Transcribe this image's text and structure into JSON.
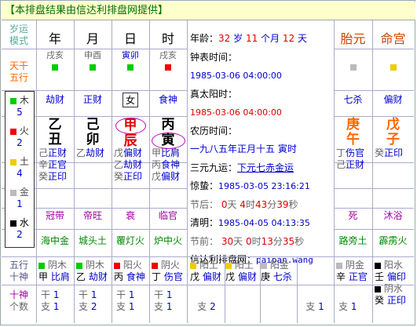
{
  "title": "【本排盘结果由信达利排盘网提供】",
  "left_col": {
    "header": [
      "岁运",
      "模式"
    ],
    "tiangan_wuxing": [
      "天干",
      "五行"
    ],
    "elements": [
      {
        "name": "木",
        "count": "5",
        "color": "#00cc00"
      },
      {
        "name": "火",
        "count": "2",
        "color": "#ee0000"
      },
      {
        "name": "土",
        "count": "4",
        "color": "#eecc00"
      },
      {
        "name": "金",
        "count": "1",
        "color": "#bbbbbb"
      },
      {
        "name": "水",
        "count": "2",
        "color": "#000000"
      }
    ],
    "wuxing_shishen": [
      "五行",
      "十神"
    ],
    "shishen_count": [
      "十神",
      "个数"
    ]
  },
  "pillars": [
    {
      "header": "年",
      "nayin_top": "戌亥",
      "sq_color": "#00cc00",
      "shishen": "劫财",
      "gan": "乙",
      "zhi": "丑",
      "canggan": [
        [
          "己",
          "正财"
        ],
        [
          "辛",
          "正官"
        ],
        [
          "癸",
          "正印"
        ]
      ],
      "changsheng": "冠带",
      "nayin": "海中金",
      "wx": [
        [
          "阴木",
          "#00cc00"
        ],
        [
          "甲",
          "比肩"
        ]
      ],
      "count": [
        "干 1",
        "支 1"
      ]
    },
    {
      "header": "月",
      "nayin_top": "申酉",
      "sq_color": "#00cc00",
      "shishen": "正财",
      "gan": "己",
      "zhi": "卯",
      "canggan": [
        [
          "乙",
          "劫财"
        ]
      ],
      "changsheng": "帝旺",
      "nayin": "城头土",
      "wx": [
        [
          "阴木",
          "#00cc00"
        ],
        [
          "乙",
          "劫财"
        ]
      ],
      "count": [
        "干 1",
        "支 2"
      ]
    },
    {
      "header": "日",
      "nayin_top": "寅卯",
      "sq_color": "#00cc00",
      "shishen": "女",
      "gan": "甲",
      "zhi": "辰",
      "canggan": [
        [
          "戊",
          "偏财"
        ],
        [
          "乙",
          "劫财"
        ],
        [
          "癸",
          "正印"
        ]
      ],
      "changsheng": "衰",
      "nayin": "覆灯火",
      "wx": [
        [
          "阳火",
          "#ee0000"
        ],
        [
          "丙",
          "食神"
        ]
      ],
      "count": [
        "干 1",
        "支 1"
      ]
    },
    {
      "header": "时",
      "nayin_top": "戌亥",
      "sq_color": "#ee0000",
      "shishen": "食神",
      "gan": "丙",
      "zhi": "寅",
      "canggan": [
        [
          "甲",
          "比肩"
        ],
        [
          "丙",
          "食神"
        ],
        [
          "戊",
          "偏财"
        ]
      ],
      "changsheng": "临官",
      "nayin": "炉中火",
      "wx": [
        [
          "阴火",
          "#ee0000"
        ],
        [
          "丁",
          "伤官"
        ]
      ],
      "count": [
        "干 1",
        "支 1"
      ]
    }
  ],
  "info": {
    "age_label": "年龄：",
    "age_num": "32",
    "age_unit": "岁",
    "month_num": "11",
    "month_unit": "个月",
    "day_num": "12",
    "day_unit": "天",
    "clock_label": "钟表时间：",
    "clock_value": "1985-03-06 04:00:00",
    "solar_label": "真太阳时：",
    "solar_value": "1985-03-06 04:00:00",
    "lunar_label": "农历时间：",
    "lunar_value": "一九八五年正月十五 寅时",
    "yuan_label": "三元九运：",
    "yuan_value": "下元七赤金运",
    "jingzhe_label": "惊蛰：",
    "jingzhe_value": "1985-03-05 23:16:21",
    "jiehou_label": "节后：",
    "jiehou_d": "0",
    "jiehou_h": "4",
    "jiehou_m": "43",
    "jiehou_s": "39",
    "qingming_label": "清明：",
    "qingming_value": "1985-04-05 04:13:35",
    "jieqian_label": "节前：",
    "jieqian_d": "30",
    "jieqian_h": "0",
    "jieqian_m": "13",
    "jieqian_s": "35",
    "unit_tian": "天",
    "unit_shi": "时",
    "unit_fen": "分",
    "unit_miao": "秒",
    "site_label": "信达利排盘网：",
    "site_value": "paipan.wang",
    "bottom": [
      [
        "阳土",
        "#eecc00"
      ],
      [
        "戊",
        "偏财"
      ],
      [
        "阳土",
        "#eecc00"
      ],
      [
        "戊",
        "偏财"
      ],
      [
        "阳金",
        "#bbbbbb"
      ],
      [
        "庚",
        "七杀"
      ]
    ],
    "count": [
      "支 2",
      "支 1"
    ]
  },
  "right_cols": [
    {
      "header": "胎元",
      "sq_color": "#bbbbbb",
      "shishen": "七杀",
      "gan": "庚",
      "zhi": "午",
      "canggan": [
        [
          "丁",
          "伤官"
        ],
        [
          "己",
          "正财"
        ]
      ],
      "changsheng": "死",
      "nayin": "路旁土",
      "wx": [
        [
          "阴金",
          "#bbbbbb"
        ],
        [
          "辛",
          "正官"
        ]
      ],
      "count": [
        "",
        "支 1"
      ]
    },
    {
      "header": "命宫",
      "sq_color": "#eecc00",
      "shishen": "偏财",
      "gan": "戊",
      "zhi": "子",
      "canggan": [
        [
          "癸",
          "正印"
        ]
      ],
      "changsheng": "沐浴",
      "nayin": "霹雳火",
      "wx": [
        [
          "阳水",
          "#000000"
        ],
        [
          "壬",
          "偏印"
        ],
        [
          "阴水",
          "#000000"
        ],
        [
          "癸",
          "正印"
        ]
      ],
      "count": [
        "",
        ""
      ]
    }
  ]
}
